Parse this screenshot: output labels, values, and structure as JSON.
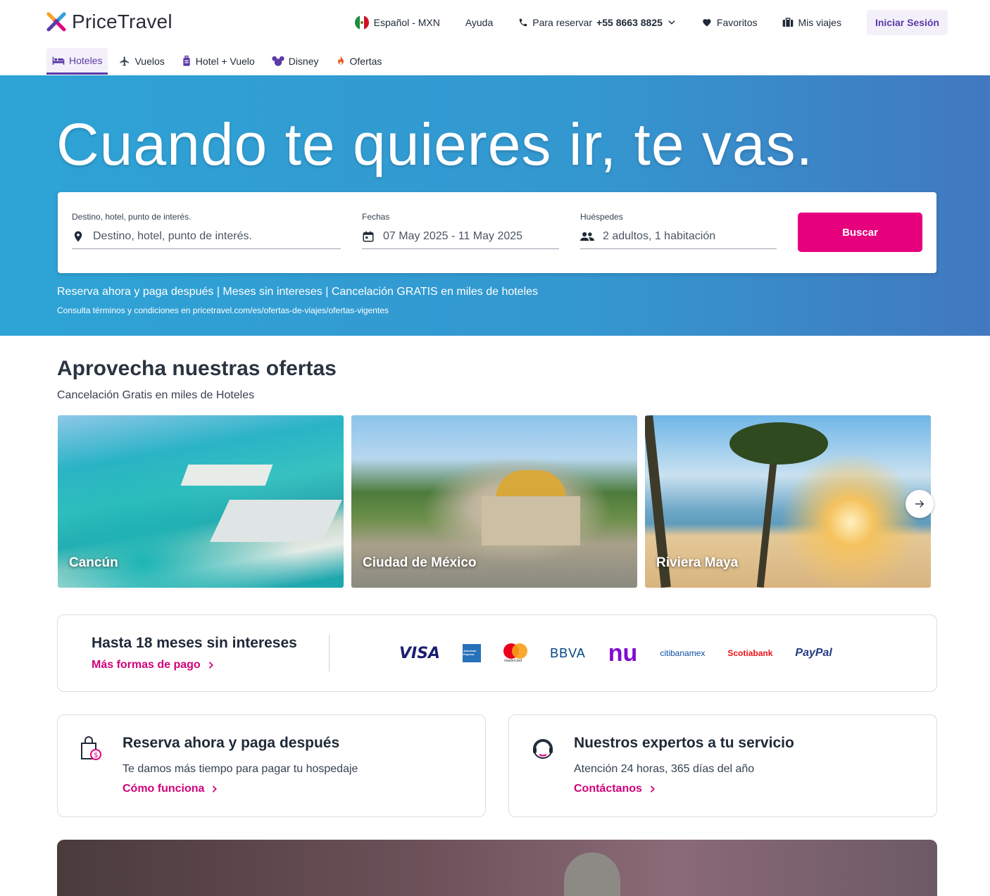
{
  "brand": {
    "name": "PriceTravel"
  },
  "topnav": {
    "language": "Español - MXN",
    "help": "Ayuda",
    "phone_prefix": "Para reservar",
    "phone_number": "+55 8663 8825",
    "favorites": "Favoritos",
    "trips": "Mis viajes",
    "login": "Iniciar Sesión"
  },
  "tabs": [
    {
      "label": "Hoteles",
      "icon": "bed-icon",
      "active": true
    },
    {
      "label": "Vuelos",
      "icon": "plane-icon",
      "active": false
    },
    {
      "label": "Hotel + Vuelo",
      "icon": "luggage-icon",
      "active": false
    },
    {
      "label": "Disney",
      "icon": "mickey-icon",
      "active": false
    },
    {
      "label": "Ofertas",
      "icon": "fire-icon",
      "active": false
    }
  ],
  "hero": {
    "title": "Cuando te quieres ir, te vas.",
    "destination_label": "Destino, hotel, punto de interés.",
    "destination_placeholder": "Destino, hotel, punto de interés.",
    "dates_label": "Fechas",
    "dates_value": "07 May 2025 - 11 May 2025",
    "guests_label": "Huéspedes",
    "guests_value": "2 adultos, 1 habitación",
    "search_button": "Buscar",
    "promo": "Reserva ahora y paga después | Meses sin intereses | Cancelación GRATIS en miles de hoteles",
    "terms": "Consulta términos y condiciones en pricetravel.com/es/ofertas-de-viajes/ofertas-vigentes"
  },
  "offers": {
    "title": "Aprovecha nuestras ofertas",
    "subtitle": "Cancelación Gratis en miles de Hoteles",
    "cards": [
      "Cancún",
      "Ciudad de México",
      "Riviera Maya"
    ]
  },
  "payment": {
    "title": "Hasta 18 meses sin intereses",
    "link": "Más formas de pago",
    "logos": [
      "VISA",
      "American Express",
      "mastercard",
      "BBVA",
      "nu",
      "citibanamex",
      "Scotiabank",
      "PayPal"
    ]
  },
  "info_cards": [
    {
      "title": "Reserva ahora y paga después",
      "desc": "Te damos más tiempo para pagar tu hospedaje",
      "link": "Cómo funciona",
      "icon": "shopping-bag-dollar-icon"
    },
    {
      "title": "Nuestros expertos a tu servicio",
      "desc": "Atención 24 horas, 365 días del año",
      "link": "Contáctanos",
      "icon": "headset-agent-icon"
    }
  ],
  "colors": {
    "accent": "#e6007e",
    "brand_purple": "#5b3aa6",
    "hero_blue": "#3497d0"
  }
}
